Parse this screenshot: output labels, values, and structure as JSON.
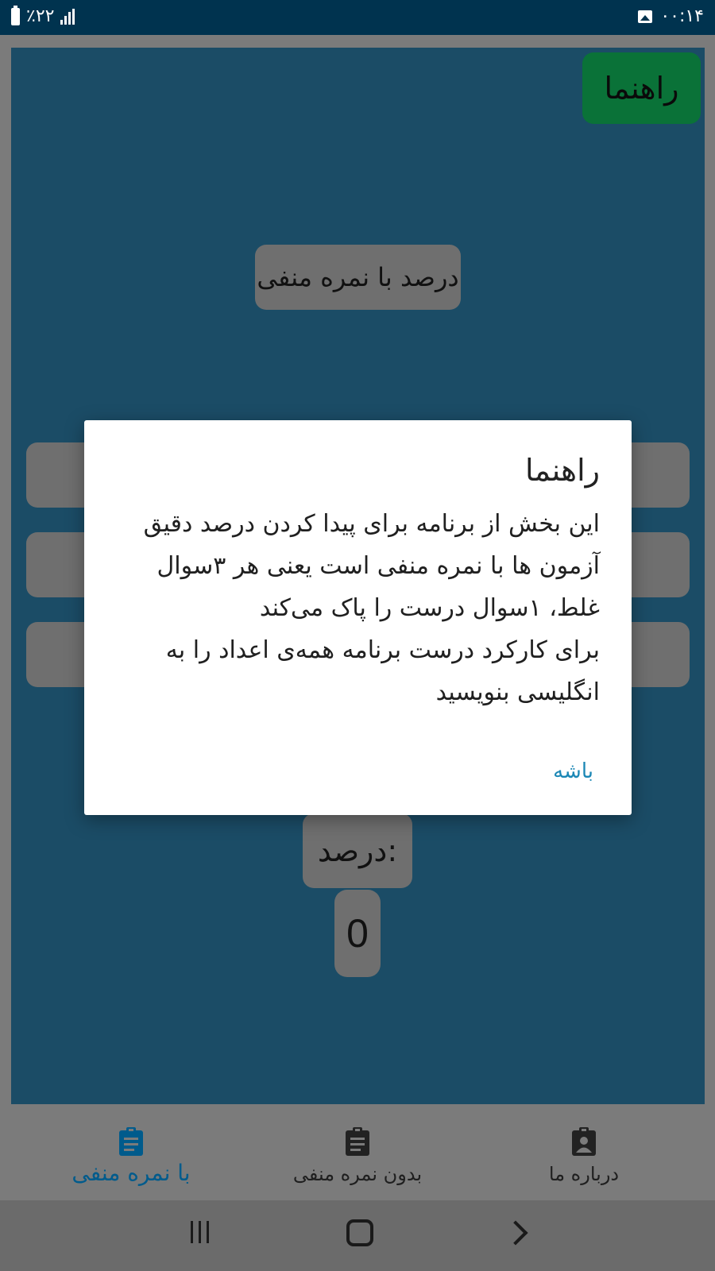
{
  "status_bar": {
    "time": "۰۰:۱۴",
    "battery": "٪۲۲",
    "icons": [
      "battery-icon",
      "signal-icon",
      "image-notification-icon"
    ]
  },
  "main": {
    "help_button": "راهنما",
    "title": "درصد با نمره منفی",
    "result_label": "درصد:",
    "result_value": "0"
  },
  "dialog": {
    "title": "راهنما",
    "lines": [
      "این بخش از برنامه برای پیدا کردن درصد دقیق",
      "آزمون ها با نمره منفی است یعنی هر ۳سوال",
      "غلط، ۱سوال درست را پاک می‌کند",
      "برای کارکرد درست برنامه همه‌ی اعداد را به",
      "انگلیسی بنویسید"
    ],
    "ok_label": "باشه"
  },
  "bottom_nav": {
    "items": [
      {
        "label": "با نمره منفی",
        "icon": "clipboard-list-icon",
        "active": true
      },
      {
        "label": "بدون نمره منفی",
        "icon": "clipboard-list-icon",
        "active": false
      },
      {
        "label": "درباره ما",
        "icon": "contact-clipboard-icon",
        "active": false
      }
    ]
  },
  "colors": {
    "status_bar": "#00334f",
    "panel": "#1b4c66",
    "help_button": "#0a7238",
    "accent": "#005b8c",
    "ok_button": "#1b87b5"
  }
}
